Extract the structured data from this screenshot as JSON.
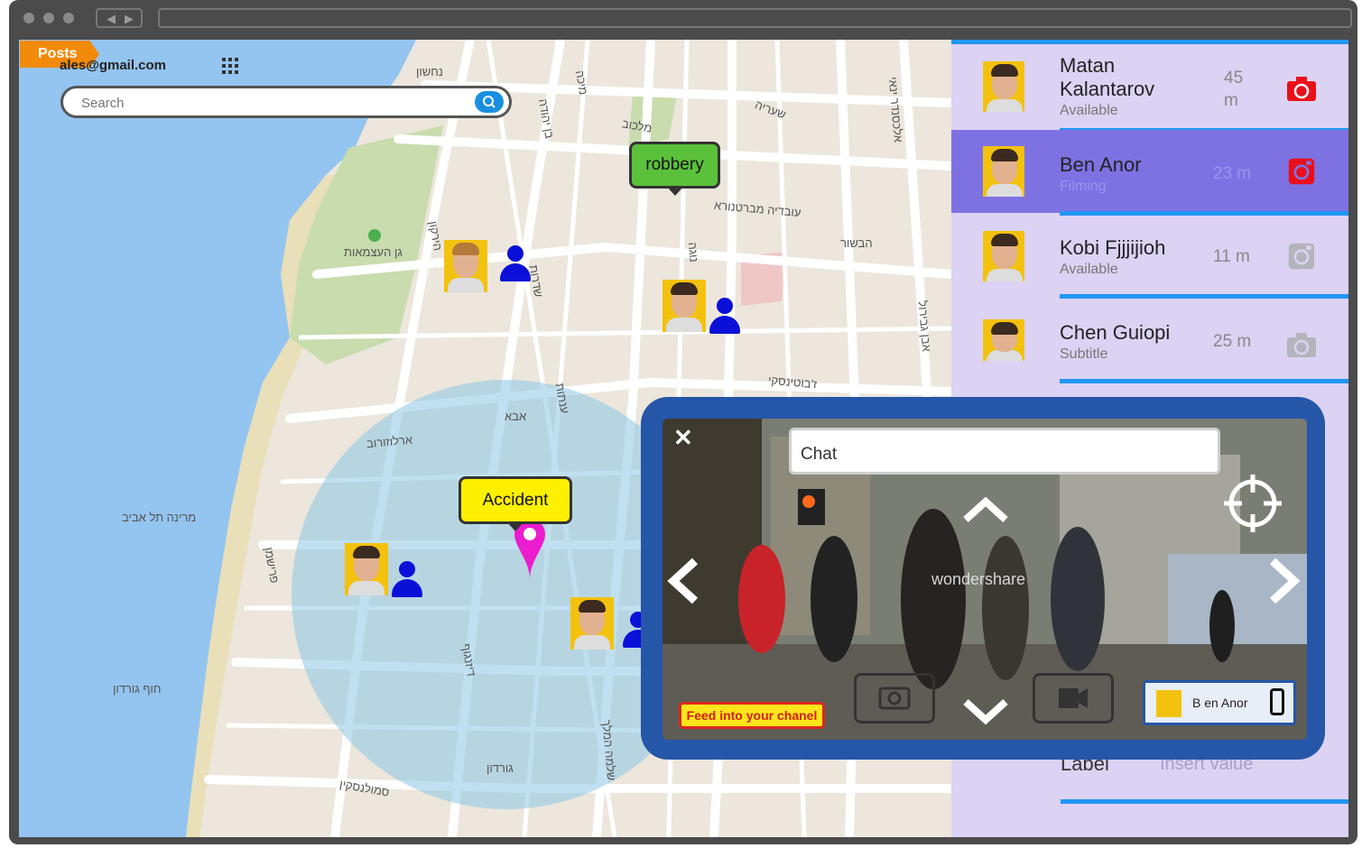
{
  "header": {
    "posts_label": "Posts",
    "email": "ales@gmail.com",
    "search_placeholder": "Search"
  },
  "map": {
    "callouts": {
      "robbery": "robbery",
      "accident": "Accident"
    },
    "street_labels": [
      "נחשון",
      "בן יהודה",
      "מיכה",
      "מלכוב",
      "גן העצמאות",
      "הירקון",
      "שדרות",
      "נוגה",
      "אבן גבירול",
      "ארלוזורוב",
      "אבא",
      "מרינה תל אביב",
      "חוף גורדון",
      "גורדון",
      "עובדיה מברטנורא",
      "סמולנסקין",
      "פרישמן",
      "דיזנגוף",
      "שלמה המלך",
      "ז'בוטינסקי",
      "ענתות",
      "שעריה",
      "אלכסנדר ינאי",
      "הבשור"
    ]
  },
  "sidebar": {
    "items": [
      {
        "name": "Matan Kalantarov",
        "status": "Available",
        "distance": "45 m"
      },
      {
        "name": "Ben Anor",
        "status": "Filming",
        "distance": "23 m"
      },
      {
        "name": "Kobi Fjjjijioh",
        "status": "Available",
        "distance": "11 m"
      },
      {
        "name": "Chen Guiopi",
        "status": "Subtitle",
        "distance": "25 m"
      }
    ],
    "label": "Label",
    "insert_value": "Insert value"
  },
  "video": {
    "chat_placeholder": "Chat",
    "feed_button": "Feed into your chanel",
    "watermark": "wondershare",
    "user_chip": "B en Anor"
  },
  "colors": {
    "accent_blue": "#2196f3",
    "sidebar_bg": "#dcd2f3",
    "active_row": "#7e72e2",
    "robbery": "#5bc13a",
    "accident": "#ffef00",
    "person_icon": "#0a10d8",
    "panel": "#2556a8"
  }
}
